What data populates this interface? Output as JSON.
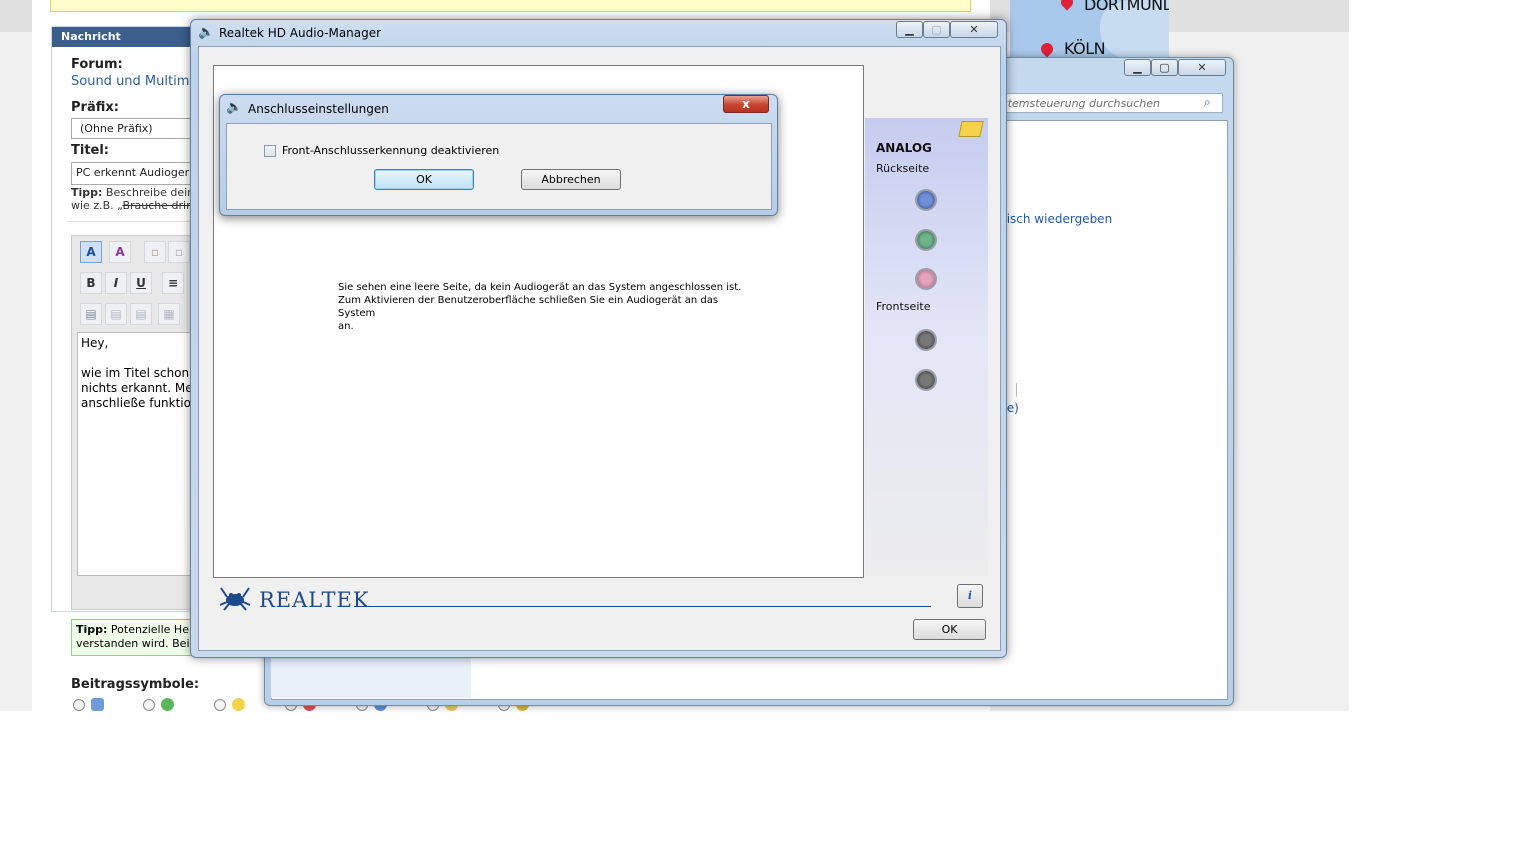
{
  "forum": {
    "panel_title": "Nachricht",
    "forum_label": "Forum:",
    "forum_value": "Sound und Multimed",
    "prefix_label": "Präfix:",
    "prefix_value": "(Ohne Präfix)",
    "title_label": "Titel:",
    "title_value": "PC erkennt Audioger",
    "tip1_bold": "Tipp:",
    "tip1_line1": "Beschreibe dein",
    "tip1_line2_prefix": "wie z.B. „",
    "tip1_line2_strike": "Brauche drin",
    "editor_text": "Hey,\n\nwie im Titel schon\nnichts erkannt. Me\nanschließe funktio",
    "tip2_bold": "Tipp:",
    "tip2_line1": "Potenzielle Hel",
    "tip2_line2": "verstanden wird. Bei",
    "post_icons_label": "Beitragssymbole:"
  },
  "map": {
    "city1": "DORTMUND",
    "city2": "KÖLN"
  },
  "control_panel": {
    "search_placeholder": "stemsteuerung durchsuchen",
    "link1": "tisch wiedergeben",
    "link2": "te)"
  },
  "realtek": {
    "window_title": "Realtek HD Audio-Manager",
    "message_line1": "Sie sehen eine leere Seite, da kein Audiogerät an das System angeschlossen ist.",
    "message_line2": "Zum Aktivieren der Benutzeroberfläche schließen Sie ein Audiogerät an das System",
    "message_line3": "an.",
    "side_heading": "ANALOG",
    "rear_label": "Rückseite",
    "front_label": "Frontseite",
    "rear_jacks": [
      "#6f8fd6",
      "#6fb38a",
      "#e3a3bd"
    ],
    "front_jacks": [
      "#777777",
      "#777777"
    ],
    "logo_text": "REALTEK",
    "ok_label": "OK",
    "info_icon": "info-icon"
  },
  "dialog": {
    "title": "Anschlusseinstellungen",
    "checkbox_label": "Front-Anschlusserkennung deaktivieren",
    "checkbox_checked": false,
    "ok_label": "OK",
    "cancel_label": "Abbrechen",
    "close_label": "x"
  }
}
